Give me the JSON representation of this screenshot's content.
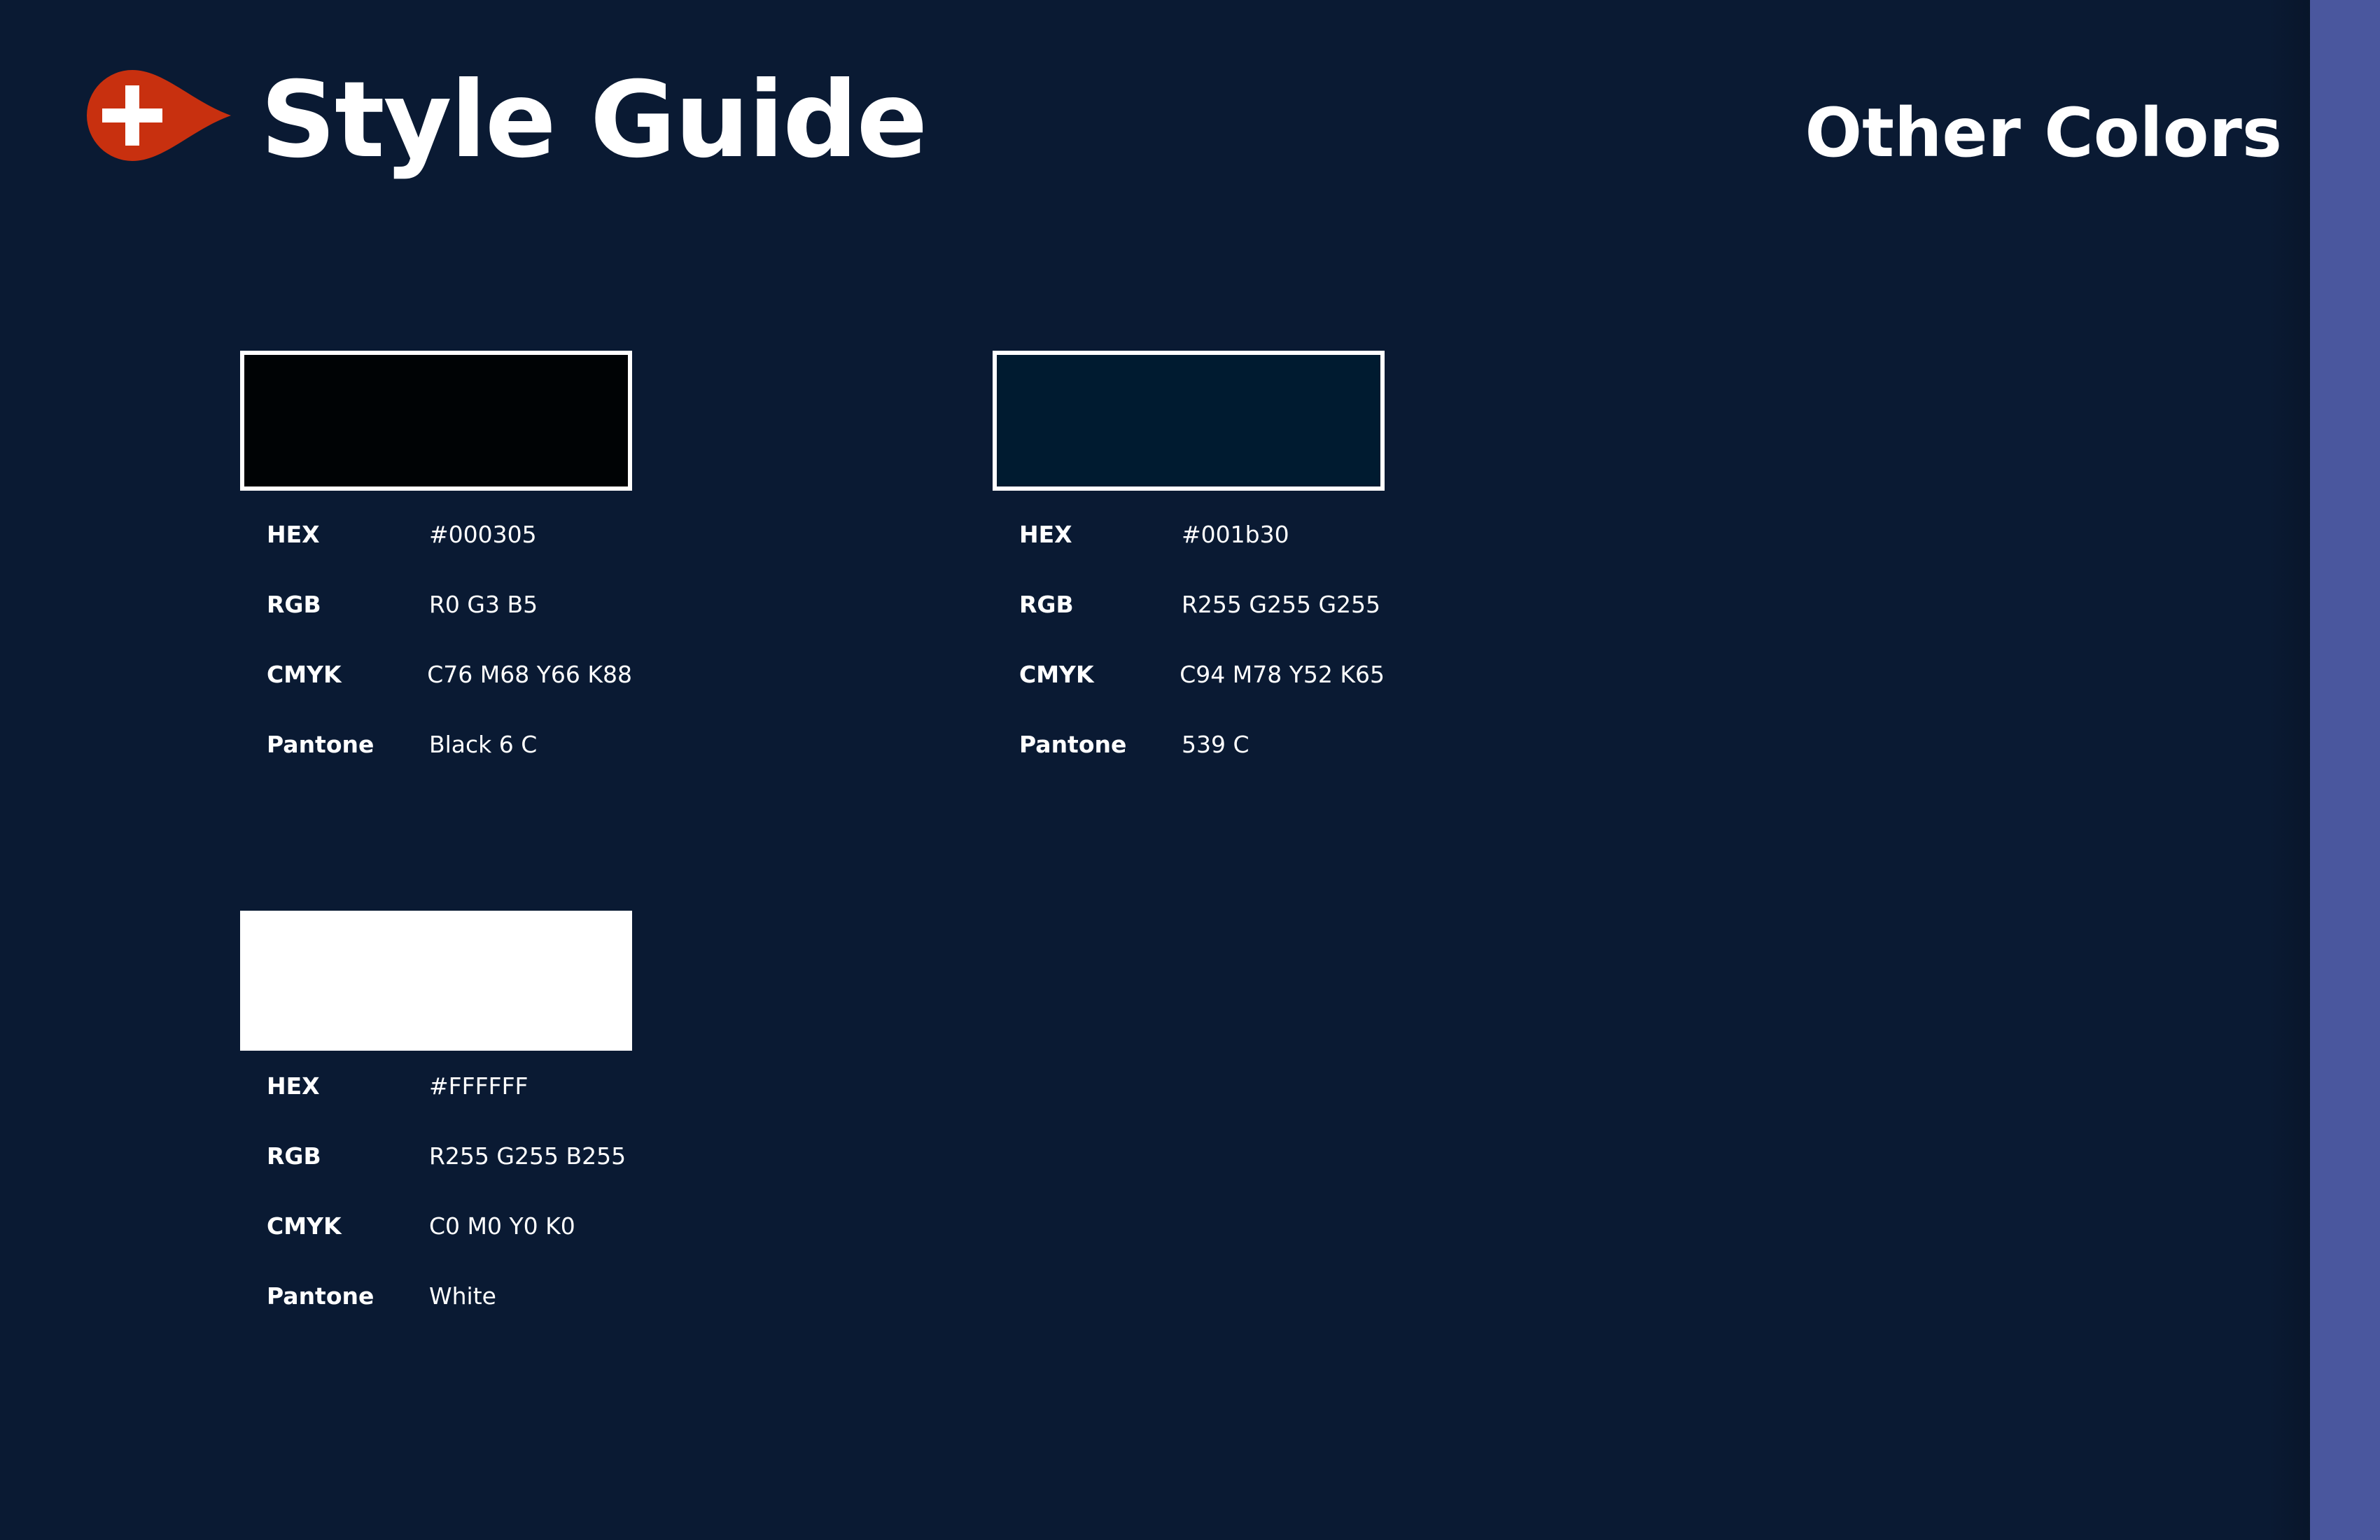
{
  "header": {
    "brand_title": "Style Guide",
    "section_title": "Other Colors"
  },
  "logo": {
    "icon": "swiss-cross-pin-icon",
    "pin_color": "#c8300f",
    "cross_color": "#ffffff"
  },
  "theme": {
    "background": "#0a1a33",
    "side_band": "#4a579e"
  },
  "labels": {
    "hex": "HEX",
    "rgb": "RGB",
    "cmyk": "CMYK",
    "pantone": "Pantone"
  },
  "swatches": [
    {
      "fill": "#000305",
      "hex": "#000305",
      "rgb": "R0 G3 B5",
      "cmyk": "C76 M68 Y66 K88",
      "pantone": "Black 6 C"
    },
    {
      "fill": "#001b30",
      "hex": "#001b30",
      "rgb": "R255 G255 G255",
      "cmyk": "C94 M78 Y52 K65",
      "pantone": "539 C"
    },
    {
      "fill": "#FFFFFF",
      "hex": "#FFFFFF",
      "rgb": "R255 G255 B255",
      "cmyk": "C0 M0 Y0 K0",
      "pantone": "White"
    }
  ]
}
